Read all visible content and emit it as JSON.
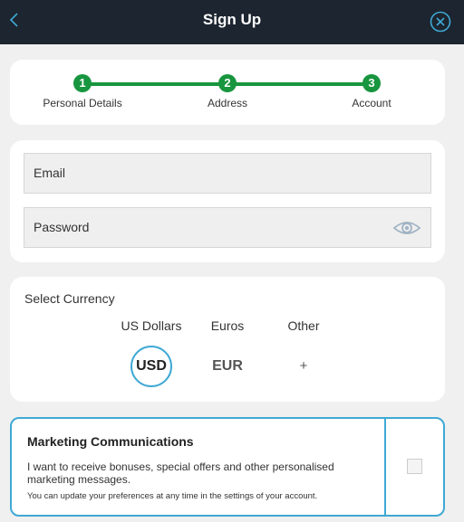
{
  "header": {
    "title": "Sign Up",
    "back_icon": "chevron-left-icon",
    "close_icon": "close-circle-icon"
  },
  "stepper": {
    "steps": [
      {
        "number": "1",
        "label": "Personal Details"
      },
      {
        "number": "2",
        "label": "Address"
      },
      {
        "number": "3",
        "label": "Account"
      }
    ],
    "active_color": "#18953f"
  },
  "credentials": {
    "email": {
      "placeholder": "Email",
      "value": ""
    },
    "password": {
      "placeholder": "Password",
      "value": "",
      "toggle_icon": "eye-icon"
    }
  },
  "currency": {
    "label": "Select Currency",
    "options": [
      {
        "name": "US Dollars",
        "code": "USD",
        "selected": true
      },
      {
        "name": "Euros",
        "code": "EUR",
        "selected": false
      },
      {
        "name": "Other",
        "code": "+",
        "selected": false
      }
    ]
  },
  "marketing": {
    "title": "Marketing Communications",
    "text": "I want to receive bonuses, special offers and other personalised marketing messages.",
    "note": "You can update your preferences at any time in the settings of your account.",
    "checked": false
  },
  "colors": {
    "header_bg": "#1c2530",
    "accent": "#3fa9d4",
    "step_green": "#18953f"
  }
}
